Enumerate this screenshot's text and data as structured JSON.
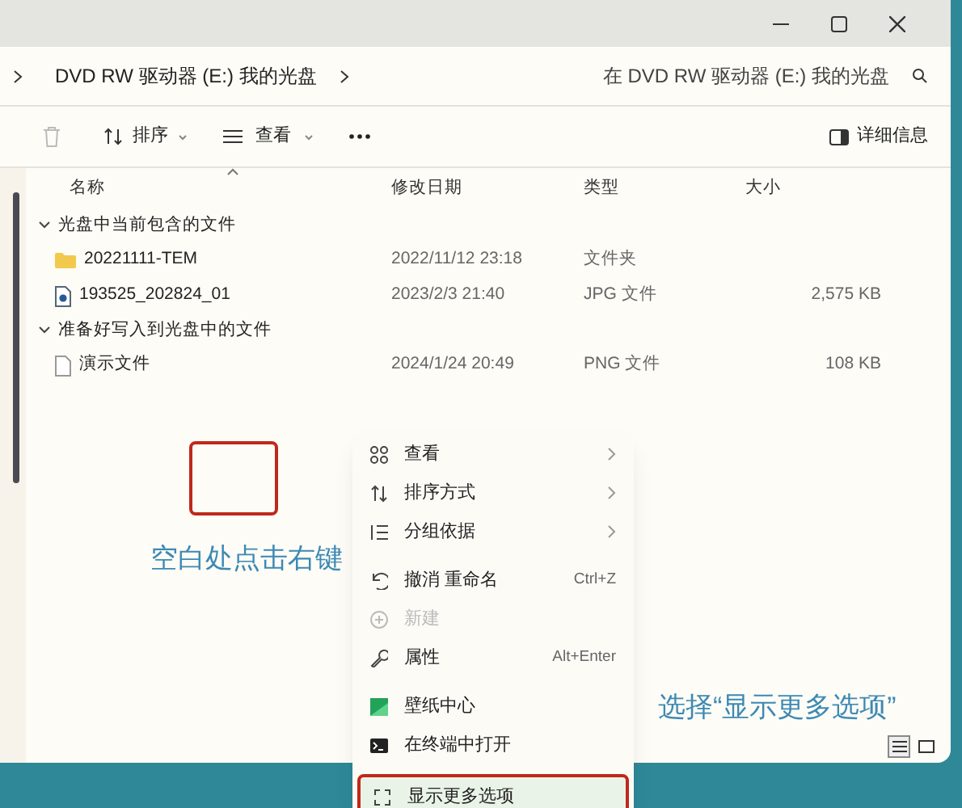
{
  "address": {
    "path": "DVD RW 驱动器 (E:) 我的光盘",
    "search_placeholder": "在 DVD RW 驱动器 (E:) 我的光盘"
  },
  "toolbar": {
    "sort": "排序",
    "view": "查看",
    "details": "详细信息"
  },
  "columns": [
    "名称",
    "修改日期",
    "类型",
    "大小"
  ],
  "groups": [
    {
      "label": "光盘中当前包含的文件",
      "expanded": true,
      "files": [
        {
          "kind": "folder",
          "name": "20221111-TEM",
          "date": "2022/11/12 23:18",
          "type": "文件夹"
        },
        {
          "kind": "image",
          "name": "193525_202824_01",
          "date": "2023/2/3 21:40",
          "type": "JPG 文件",
          "size": "2,575 KB"
        }
      ]
    },
    {
      "label": "准备好写入到光盘中的文件",
      "expanded": true,
      "files": [
        {
          "kind": "file",
          "name": "演示文件",
          "date": "2024/1/24 20:49",
          "type": "PNG 文件",
          "size": "108 KB"
        }
      ]
    }
  ],
  "annotations": [
    "空白处点击右键",
    "选择“显示更多选项”"
  ],
  "context_menu": [
    {
      "kind": "item",
      "label": "查看",
      "submenu": true,
      "disabled": false,
      "selected": false
    },
    {
      "kind": "item",
      "label": "排序方式",
      "submenu": true,
      "disabled": false,
      "selected": false
    },
    {
      "kind": "item",
      "label": "分组依据",
      "submenu": true,
      "disabled": false,
      "selected": false
    },
    {
      "kind": "separator"
    },
    {
      "kind": "item",
      "label": "撤消 重命名",
      "shortcut": "Ctrl+Z",
      "submenu": false,
      "disabled": false,
      "selected": false
    },
    {
      "kind": "item",
      "label": "新建",
      "submenu": false,
      "disabled": true,
      "selected": false
    },
    {
      "kind": "item",
      "label": "属性",
      "shortcut": "Alt+Enter",
      "submenu": false,
      "disabled": false,
      "selected": false
    },
    {
      "kind": "separator"
    },
    {
      "kind": "item",
      "label": "壁纸中心",
      "submenu": false,
      "disabled": false,
      "selected": false
    },
    {
      "kind": "item",
      "label": "在终端中打开",
      "submenu": false,
      "disabled": false,
      "selected": false
    },
    {
      "kind": "separator"
    },
    {
      "kind": "item",
      "label": "显示更多选项",
      "submenu": false,
      "disabled": false,
      "selected": true
    }
  ],
  "view_modes": [
    {
      "selected": true
    },
    {
      "selected": false
    }
  ]
}
